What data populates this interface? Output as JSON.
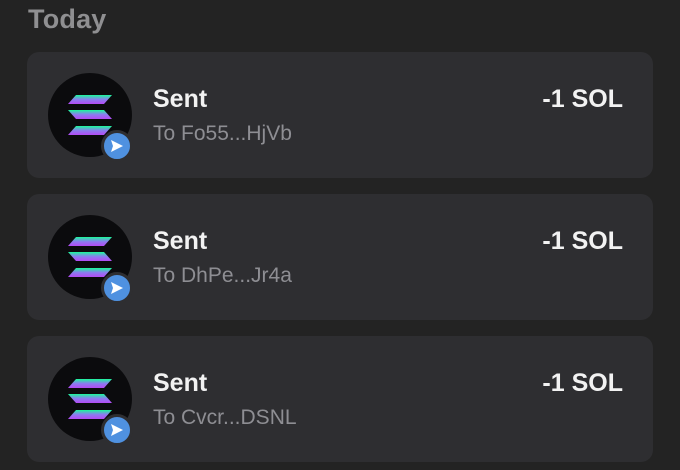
{
  "section": {
    "title": "Today"
  },
  "transactions": [
    {
      "title": "Sent",
      "subtitle": "To Fo55...HjVb",
      "amount": "-1 SOL",
      "token_icon": "solana-logo-icon",
      "badge_icon": "send-arrow-icon"
    },
    {
      "title": "Sent",
      "subtitle": "To DhPe...Jr4a",
      "amount": "-1 SOL",
      "token_icon": "solana-logo-icon",
      "badge_icon": "send-arrow-icon"
    },
    {
      "title": "Sent",
      "subtitle": "To Cvcr...DSNL",
      "amount": "-1 SOL",
      "token_icon": "solana-logo-icon",
      "badge_icon": "send-arrow-icon"
    }
  ],
  "colors": {
    "background": "#232323",
    "card": "#2e2e31",
    "badge": "#4f91e0",
    "solana_gradient_start": "#00ffa3",
    "solana_gradient_end": "#dc1fff"
  }
}
